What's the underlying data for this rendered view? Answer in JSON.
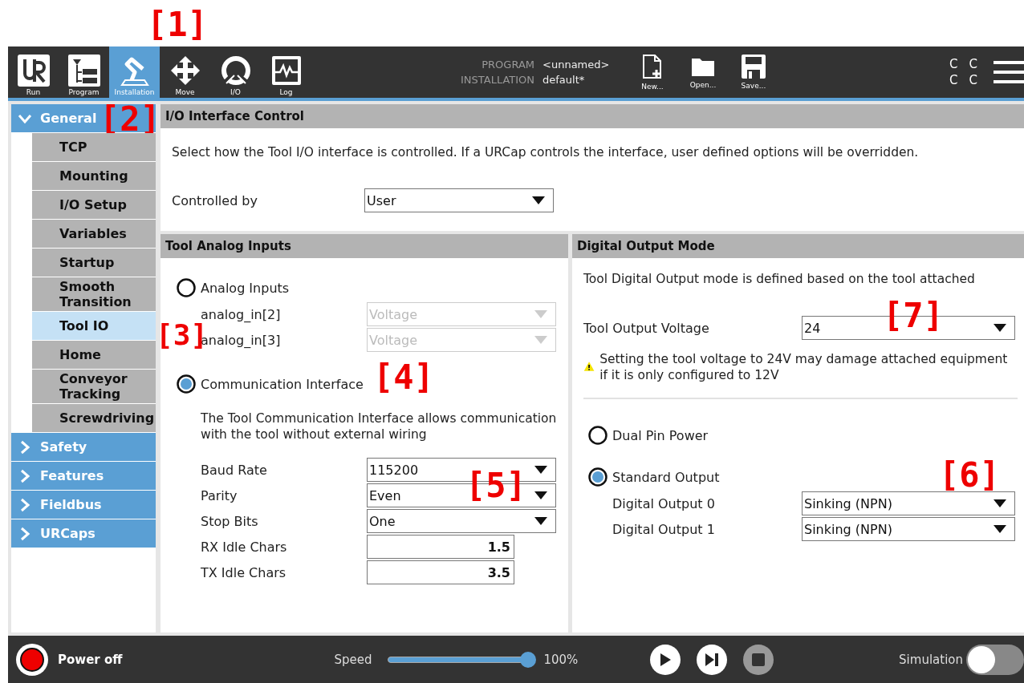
{
  "top_nav": [
    {
      "label": "Run",
      "selected": false
    },
    {
      "label": "Program",
      "selected": false
    },
    {
      "label": "Installation",
      "selected": true
    },
    {
      "label": "Move",
      "selected": false
    },
    {
      "label": "I/O",
      "selected": false
    },
    {
      "label": "Log",
      "selected": false
    }
  ],
  "program_info": [
    {
      "label": "PROGRAM",
      "value": "<unnamed>"
    },
    {
      "label": "INSTALLATION",
      "value": "default*"
    }
  ],
  "file_buttons": [
    "New...",
    "Open...",
    "Save..."
  ],
  "status_letters": [
    "C",
    "C",
    "C",
    "C"
  ],
  "sidebar": [
    {
      "label": "General",
      "expanded": true,
      "children": [
        {
          "label": "TCP",
          "selected": false
        },
        {
          "label": "Mounting",
          "selected": false
        },
        {
          "label": "I/O Setup",
          "selected": false
        },
        {
          "label": "Variables",
          "selected": false
        },
        {
          "label": "Startup",
          "selected": false
        },
        {
          "label": "Smooth Transition",
          "selected": false
        },
        {
          "label": "Tool IO",
          "selected": true
        },
        {
          "label": "Home",
          "selected": false
        },
        {
          "label": "Conveyor Tracking",
          "selected": false
        },
        {
          "label": "Screwdriving",
          "selected": false
        }
      ]
    },
    {
      "label": "Safety",
      "expanded": false
    },
    {
      "label": "Features",
      "expanded": false
    },
    {
      "label": "Fieldbus",
      "expanded": false
    },
    {
      "label": "URCaps",
      "expanded": false
    }
  ],
  "io_interface_control": {
    "title": "I/O Interface Control",
    "description": "Select how the Tool I/O interface is controlled. If a URCap controls the interface, user defined options will be overridden.",
    "controlled_by": {
      "label": "Controlled by",
      "value": "User"
    }
  },
  "tool_analog_inputs": {
    "title": "Tool Analog Inputs",
    "options": [
      {
        "label": "Analog Inputs",
        "selected": false,
        "fields": [
          {
            "kind": "dropdown",
            "label": "analog_in[2]",
            "value": "Voltage",
            "disabled": true
          },
          {
            "kind": "dropdown",
            "label": "analog_in[3]",
            "value": "Voltage",
            "disabled": true
          }
        ]
      },
      {
        "label": "Communication Interface",
        "selected": true,
        "description": "The Tool Communication Interface allows communication with the tool without external wiring",
        "fields": [
          {
            "kind": "dropdown",
            "label": "Baud Rate",
            "value": "115200",
            "disabled": false
          },
          {
            "kind": "dropdown",
            "label": "Parity",
            "value": "Even",
            "disabled": false
          },
          {
            "kind": "dropdown",
            "label": "Stop Bits",
            "value": "One",
            "disabled": false
          },
          {
            "kind": "number",
            "label": "RX Idle Chars",
            "value": "1.5"
          },
          {
            "kind": "number",
            "label": "TX Idle Chars",
            "value": "3.5"
          }
        ]
      }
    ]
  },
  "digital_output_mode": {
    "title": "Digital Output Mode",
    "description": "Tool Digital Output mode is defined based on the tool attached",
    "voltage": {
      "label": "Tool Output Voltage",
      "value": "24"
    },
    "warning": "Setting the tool voltage to 24V may damage attached equipment if it is only configured to 12V",
    "options": [
      {
        "label": "Dual Pin Power",
        "selected": false
      },
      {
        "label": "Standard Output",
        "selected": true,
        "fields": [
          {
            "kind": "dropdown",
            "label": "Digital Output 0",
            "value": "Sinking (NPN)",
            "disabled": false
          },
          {
            "kind": "dropdown",
            "label": "Digital Output 1",
            "value": "Sinking (NPN)",
            "disabled": false
          }
        ]
      }
    ]
  },
  "bottom_bar": {
    "power": "Power off",
    "speed_label": "Speed",
    "speed": {
      "level": 1
    },
    "speed_reading": "100%",
    "playback": [
      {
        "kind": "play",
        "disabled": false
      },
      {
        "kind": "step",
        "disabled": false
      },
      {
        "kind": "stop",
        "disabled": true
      }
    ],
    "simulation": {
      "label": "Simulation",
      "on": false
    }
  },
  "callouts": [
    "[1]",
    "[2]",
    "[3]",
    "[4]",
    "[5]",
    "[6]",
    "[7]"
  ]
}
